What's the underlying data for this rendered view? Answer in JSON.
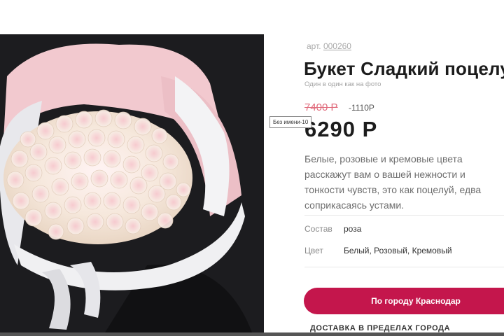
{
  "product": {
    "sku_label": "арт.",
    "sku_number": "000260",
    "title": "Букет Сладкий поцелуй",
    "subtitle": "Один в один как на фото",
    "old_price": "7400 Р",
    "discount": "-1110Р",
    "price": "6290 Р",
    "description": "Белые, розовые и кремовые цвета расскажут вам о вашей нежности и тонкости чувств, это как поцелуй, едва соприкасаясь устами.",
    "properties": [
      {
        "label": "Состав",
        "value": "роза"
      },
      {
        "label": "Цвет",
        "value": "Белый, Розовый, Кремовый"
      }
    ]
  },
  "actions": {
    "city_button": "По городу Краснодар",
    "delivery_text": "ДОСТАВКА В ПРЕДЕЛАХ ГОРОДА"
  },
  "tooltip": "Без имени-10",
  "colors": {
    "accent": "#c4164c",
    "old_price": "#e06a7b"
  }
}
